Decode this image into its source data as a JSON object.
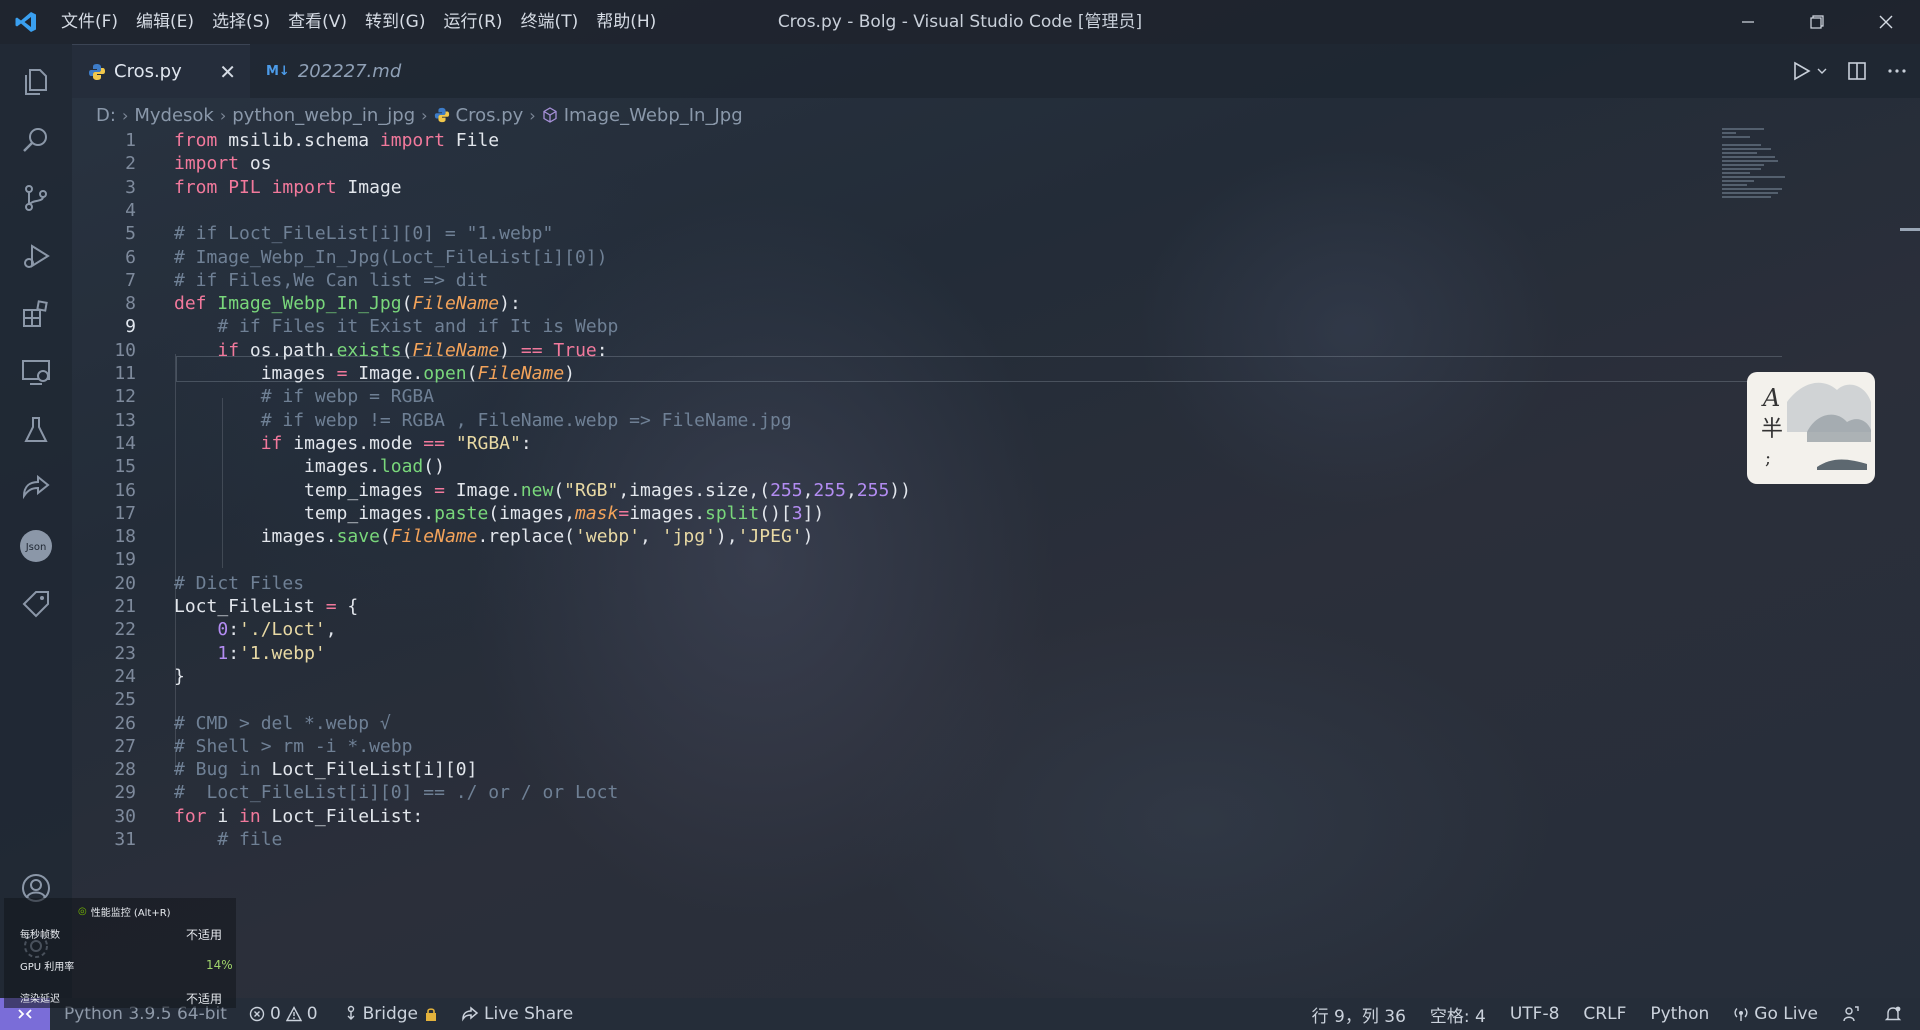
{
  "window": {
    "title": "Cros.py - Bolg - Visual Studio Code [管理员]"
  },
  "menu": [
    "文件(F)",
    "编辑(E)",
    "选择(S)",
    "查看(V)",
    "转到(G)",
    "运行(R)",
    "终端(T)",
    "帮助(H)"
  ],
  "tabs": [
    {
      "label": "Cros.py",
      "icon": "python-icon",
      "active": true
    },
    {
      "label": "202227.md",
      "icon": "markdown-icon",
      "badge": "M↓",
      "active": false
    }
  ],
  "breadcrumb": [
    "D:",
    "Mydesok",
    "python_webp_in_jpg",
    "Cros.py",
    "Image_Webp_In_Jpg"
  ],
  "editor": {
    "current_line": 9,
    "lines": [
      {
        "n": "1",
        "html": "<span class=\"kw\">from</span> msilib.schema <span class=\"kw\">import</span> File"
      },
      {
        "n": "2",
        "html": "<span class=\"kw\">import</span> os"
      },
      {
        "n": "3",
        "html": "<span class=\"kw\">from</span> <span class=\"kw\">PIL</span> <span class=\"kw\">import</span> Image"
      },
      {
        "n": "4",
        "html": ""
      },
      {
        "n": "5",
        "html": "<span class=\"cm\"># if Loct_FileList[i][0] = \"1.webp\"</span>"
      },
      {
        "n": "6",
        "html": "<span class=\"cm\"># Image_Webp_In_Jpg(Loct_FileList[i][0])</span>"
      },
      {
        "n": "7",
        "html": "<span class=\"cm\"># if Files,We Can list => dit</span>"
      },
      {
        "n": "8",
        "html": "<span class=\"kw\">def</span> <span class=\"fn\">Image_Webp_In_Jpg</span>(<span class=\"pr\">FileName</span>):"
      },
      {
        "n": "9",
        "html": "    <span class=\"cm\"># if Files it Exist and if It is Webp</span>"
      },
      {
        "n": "10",
        "html": "    <span class=\"kw\">if</span> os.path.<span class=\"fn\">exists</span>(<span class=\"pr\">FileName</span>) <span class=\"kw\">==</span> <span class=\"bi\">True</span>:"
      },
      {
        "n": "11",
        "html": "        images <span class=\"kw\">=</span> Image.<span class=\"fn\">open</span>(<span class=\"pr\">FileName</span>)"
      },
      {
        "n": "12",
        "html": "        <span class=\"cm\"># if webp = RGBA</span>"
      },
      {
        "n": "13",
        "html": "        <span class=\"cm\"># if webp != RGBA , FileName.webp => FileName.jpg</span>"
      },
      {
        "n": "14",
        "html": "        <span class=\"kw\">if</span> images.mode <span class=\"kw\">==</span> <span class=\"st\">\"RGBA\"</span>:"
      },
      {
        "n": "15",
        "html": "            images.<span class=\"fn\">load</span>()"
      },
      {
        "n": "16",
        "html": "            temp_images <span class=\"kw\">=</span> Image.<span class=\"fn\">new</span>(<span class=\"st\">\"RGB\"</span>,images.size,(<span class=\"num\">255</span>,<span class=\"num\">255</span>,<span class=\"num\">255</span>))"
      },
      {
        "n": "17",
        "html": "            temp_images.<span class=\"fn\">paste</span>(images,<span class=\"pr\">mask</span><span class=\"kw\">=</span>images.<span class=\"fn\">split</span>()[<span class=\"num\">3</span>])"
      },
      {
        "n": "18",
        "html": "        images.<span class=\"fn\">save</span>(<span class=\"pr\">FileName</span>.replace(<span class=\"st\">'webp'</span>, <span class=\"st\">'jpg'</span>),<span class=\"st\">'JPEG'</span>)"
      },
      {
        "n": "19",
        "html": ""
      },
      {
        "n": "20",
        "html": "<span class=\"cm\"># Dict Files</span>"
      },
      {
        "n": "21",
        "html": "Loct_FileList <span class=\"kw\">=</span> {"
      },
      {
        "n": "22",
        "html": "    <span class=\"num\">0</span>:<span class=\"st\">'./Loct'</span>,"
      },
      {
        "n": "23",
        "html": "    <span class=\"num\">1</span>:<span class=\"st\">'1.webp'</span>"
      },
      {
        "n": "24",
        "html": "}"
      },
      {
        "n": "25",
        "html": ""
      },
      {
        "n": "26",
        "html": "<span class=\"cm\"># CMD > del *.webp √</span>"
      },
      {
        "n": "27",
        "html": "<span class=\"cm\"># Shell > rm -i *.webp</span>"
      },
      {
        "n": "28",
        "html": "<span class=\"cm\"># Bug in</span> Loct_FileList[i][0]"
      },
      {
        "n": "29",
        "html": "<span class=\"cm\">#  Loct_FileList[i][0] == ./ or / or Loct</span>"
      },
      {
        "n": "30",
        "html": "<span class=\"kw\">for</span> i <span class=\"kw\">in</span> Loct_FileList:"
      },
      {
        "n": "31",
        "html": "<span class=\"cm\">    # file</span>"
      }
    ]
  },
  "perf_overlay": {
    "title": "性能监控 (Alt+R)",
    "rows": [
      {
        "label": "每秒帧数",
        "value": "不适用"
      },
      {
        "label": "GPU 利用率",
        "value": "14%"
      },
      {
        "label": "渲染延迟",
        "value": "不适用"
      }
    ]
  },
  "status": {
    "interpreter": "Python 3.9.5 64-bit",
    "errors": "0",
    "warnings": "0",
    "bridge": "Bridge",
    "live_share": "Live Share",
    "position": "行 9，列 36",
    "spaces": "空格: 4",
    "encoding": "UTF-8",
    "eol": "CRLF",
    "language": "Python",
    "go_live": "Go Live"
  },
  "colors": {
    "accent": "#7a6dd8",
    "keyword": "#f2799c",
    "function": "#79d77b",
    "param": "#f3a35a",
    "string": "#e8d9a4",
    "number": "#b38cf2",
    "comment": "#6f8095"
  }
}
